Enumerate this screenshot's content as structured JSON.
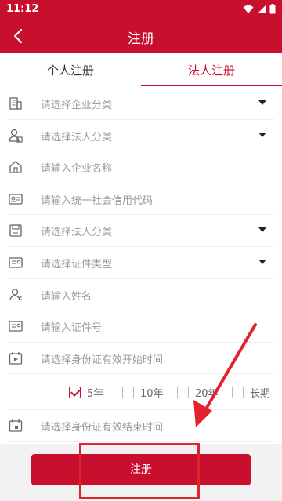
{
  "status_bar": {
    "time": "11:12"
  },
  "app_bar": {
    "title": "注册"
  },
  "tabs": [
    {
      "label": "个人注册",
      "active": false
    },
    {
      "label": "法人注册",
      "active": true
    }
  ],
  "form": {
    "rows": [
      {
        "icon": "building-icon",
        "placeholder": "请选择企业分类",
        "dropdown": true
      },
      {
        "icon": "person-badge-icon",
        "placeholder": "请选择法人分类",
        "dropdown": true
      },
      {
        "icon": "home-icon",
        "placeholder": "请输入企业名称",
        "dropdown": false
      },
      {
        "icon": "id-card-icon",
        "placeholder": "请输入统一社会信用代码",
        "dropdown": false
      },
      {
        "icon": "save-icon",
        "placeholder": "请选择法人分类",
        "dropdown": true
      },
      {
        "icon": "document-icon",
        "placeholder": "请选择证件类型",
        "dropdown": true
      },
      {
        "icon": "user-icon",
        "placeholder": "请输入姓名",
        "dropdown": false
      },
      {
        "icon": "id-card-icon",
        "placeholder": "请输入证件号",
        "dropdown": false
      },
      {
        "icon": "calendar-play-icon",
        "placeholder": "请选择身份证有效开始时间",
        "dropdown": false
      }
    ],
    "durations": [
      {
        "label": "5年",
        "checked": true
      },
      {
        "label": "10年",
        "checked": false
      },
      {
        "label": "20年",
        "checked": false
      },
      {
        "label": "长期",
        "checked": false
      }
    ],
    "end_time": {
      "icon": "calendar-icon",
      "placeholder": "请选择身份证有效结束时间"
    }
  },
  "submit_label": "注册",
  "colors": {
    "primary": "#c8102e",
    "annotation": "#e2232e",
    "placeholder": "#999999"
  }
}
